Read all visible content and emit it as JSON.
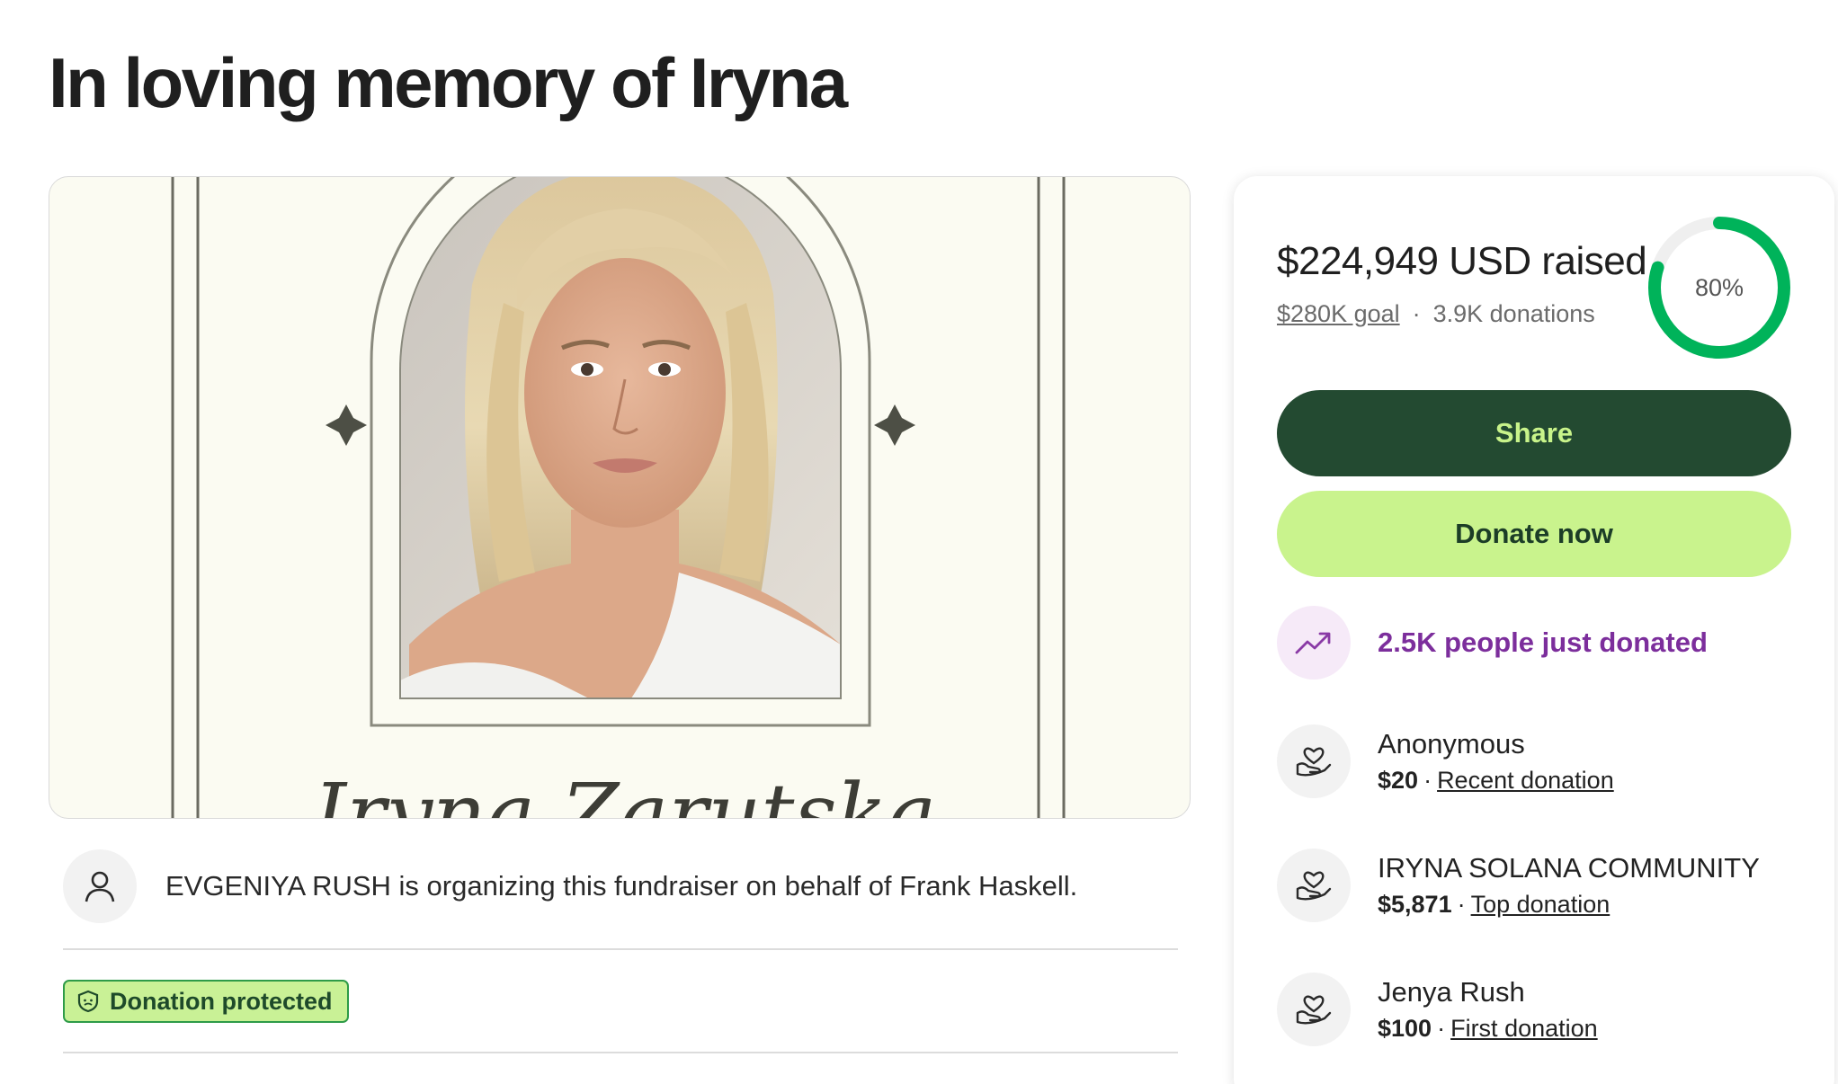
{
  "page": {
    "title": "In loving memory of Iryna"
  },
  "hero": {
    "name_text": "Iryna Zarutska"
  },
  "organizer": {
    "text": "EVGENIYA RUSH is organizing this fundraiser on behalf of Frank Haskell.",
    "icon": "person-icon"
  },
  "badge": {
    "label": "Donation protected",
    "icon": "shield-icon"
  },
  "stats": {
    "raised": "$224,949 USD raised",
    "goal": "$280K goal",
    "separator": "·",
    "donations": "3.9K donations",
    "percent_label": "80%",
    "progress_fraction": 0.8
  },
  "buttons": {
    "share": "Share",
    "donate": "Donate now"
  },
  "trend": {
    "text": "2.5K people just donated",
    "icon": "trending-up-icon"
  },
  "donors": [
    {
      "name": "Anonymous",
      "amount": "$20",
      "sep": "·",
      "kind": "Recent donation",
      "icon": "heart-hand-icon"
    },
    {
      "name": "IRYNA SOLANA COMMUNITY",
      "amount": "$5,871",
      "sep": "·",
      "kind": "Top donation",
      "icon": "heart-hand-icon"
    },
    {
      "name": "Jenya Rush",
      "amount": "$100",
      "sep": "·",
      "kind": "First donation",
      "icon": "heart-hand-icon"
    }
  ],
  "colors": {
    "share_bg": "#234a31",
    "share_text": "#c8f38a",
    "donate_bg": "#c9f38d",
    "progress": "#00b35a",
    "trend_text": "#7c2e9c"
  }
}
